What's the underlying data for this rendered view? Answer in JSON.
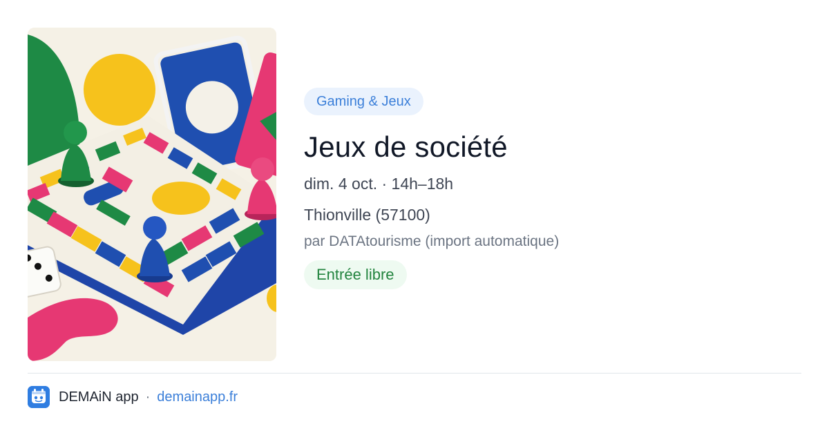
{
  "event": {
    "category": "Gaming & Jeux",
    "title": "Jeux de société",
    "date_time": "dim. 4 oct. · 14h–18h",
    "location": "Thionville (57100)",
    "organizer": "par DATAtourisme (import automatique)",
    "price": "Entrée libre",
    "image_icon": "board-game-illustration"
  },
  "footer": {
    "app_name": "DEMAiN app",
    "separator": "·",
    "domain": "demainapp.fr",
    "app_icon": "demain-app-icon"
  },
  "colors": {
    "accent_blue": "#3b7fd9",
    "category_bg": "#eaf2fd",
    "price_green": "#23843f",
    "price_bg": "#eefaf1",
    "title": "#111827",
    "divider": "#e1e6eb"
  }
}
